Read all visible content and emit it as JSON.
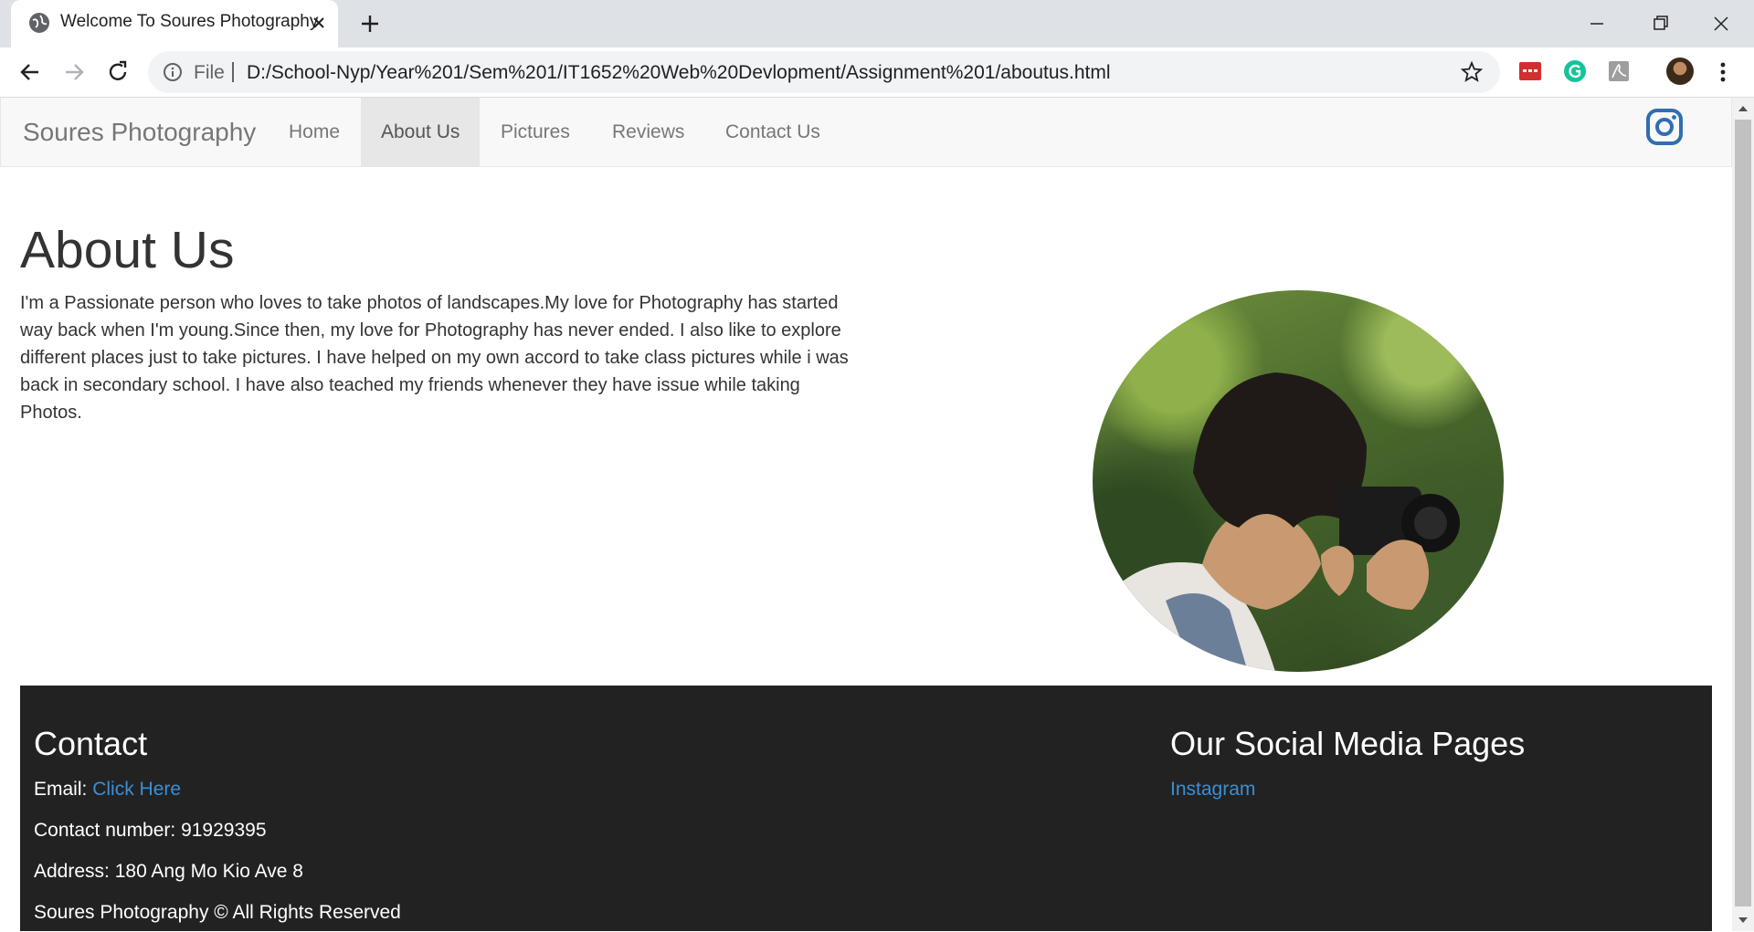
{
  "browser": {
    "tab_title": "Welcome To Soures Photography",
    "scheme_label": "File",
    "url": "D:/School-Nyp/Year%201/Sem%201/IT1652%20Web%20Devlopment/Assignment%201/aboutus.html"
  },
  "nav": {
    "brand": "Soures Photography",
    "links": [
      "Home",
      "About Us",
      "Pictures",
      "Reviews",
      "Contact Us"
    ],
    "active": "About Us"
  },
  "about": {
    "title": "About Us",
    "body": "I'm a Passionate person who loves to take photos of landscapes.My love for Photography has started way back when I'm young.Since then, my love for Photography has never ended. I also like to explore different places just to take pictures. I have helped on my own accord to take class pictures while i was back in secondary school. I have also teached my friends whenever they have issue while taking Photos."
  },
  "footer": {
    "contact_heading": "Contact",
    "email_label": "Email:",
    "email_link": "Click Here",
    "contact_number": "Contact number: 91929395",
    "address": "Address: 180 Ang Mo Kio Ave 8",
    "copyright": "Soures Photography © All Rights Reserved",
    "social_heading": "Our Social Media Pages",
    "social_link": "Instagram"
  },
  "colors": {
    "link": "#3a8fd6",
    "footer_bg": "#222222",
    "navbar_bg": "#f8f8f8",
    "instagram_icon": "#2f6eb1"
  }
}
